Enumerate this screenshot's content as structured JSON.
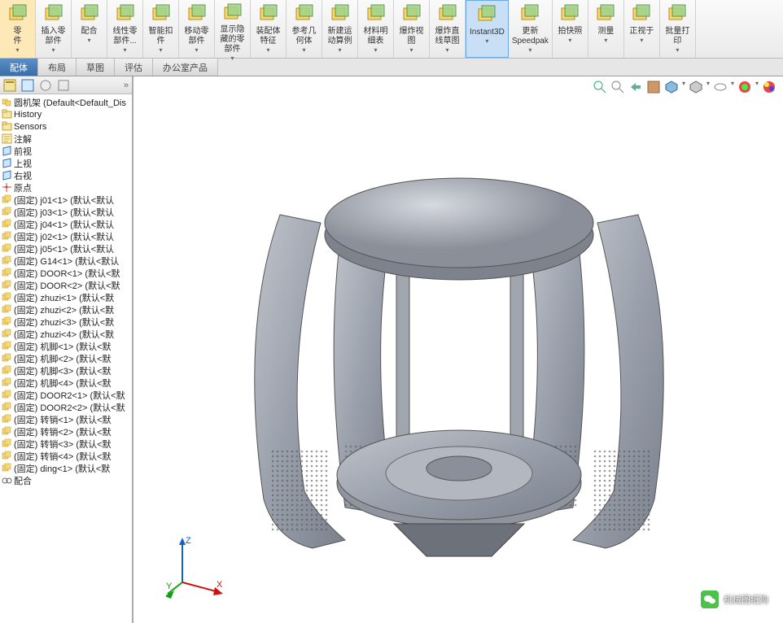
{
  "ribbon": [
    {
      "label": "零\n件",
      "name": "edit-part"
    },
    {
      "label": "插入零\n部件",
      "name": "insert-part"
    },
    {
      "label": "配合",
      "name": "mate"
    },
    {
      "label": "线性零\n部件...",
      "name": "linear-pattern"
    },
    {
      "label": "智能扣\n件",
      "name": "smart-fastener"
    },
    {
      "label": "移动零\n部件",
      "name": "move-component"
    },
    {
      "label": "显示隐\n藏的零\n部件",
      "name": "show-hidden"
    },
    {
      "label": "装配体\n特征",
      "name": "assembly-feature"
    },
    {
      "label": "参考几\n何体",
      "name": "reference-geom"
    },
    {
      "label": "新建运\n动算例",
      "name": "motion-study"
    },
    {
      "label": "材料明\n细表",
      "name": "bom"
    },
    {
      "label": "爆炸视\n图",
      "name": "explode-view"
    },
    {
      "label": "爆炸直\n线草图",
      "name": "explode-line"
    },
    {
      "label": "Instant3D",
      "name": "instant3d",
      "active": true
    },
    {
      "label": "更新\nSpeedpak",
      "name": "update-speedpak"
    },
    {
      "label": "拍快照",
      "name": "snapshot"
    },
    {
      "label": "测量",
      "name": "measure"
    },
    {
      "label": "正视于",
      "name": "normal-to"
    },
    {
      "label": "批量打\n印",
      "name": "batch-print"
    }
  ],
  "tabs": [
    {
      "label": "配体",
      "active": true
    },
    {
      "label": "布局"
    },
    {
      "label": "草图"
    },
    {
      "label": "评估"
    },
    {
      "label": "办公室产品"
    }
  ],
  "tree": {
    "root": "圆机架  (Default<Default_Dis",
    "items": [
      {
        "icon": "folder",
        "label": "History"
      },
      {
        "icon": "folder",
        "label": "Sensors"
      },
      {
        "icon": "ann",
        "label": "注解"
      },
      {
        "icon": "plane",
        "label": "前视"
      },
      {
        "icon": "plane",
        "label": "上视"
      },
      {
        "icon": "plane",
        "label": "右视"
      },
      {
        "icon": "origin",
        "label": "原点"
      },
      {
        "icon": "part",
        "label": "(固定) j01<1> (默认<默认"
      },
      {
        "icon": "part",
        "label": "(固定) j03<1> (默认<默认"
      },
      {
        "icon": "part",
        "label": "(固定) j04<1> (默认<默认"
      },
      {
        "icon": "part",
        "label": "(固定) j02<1> (默认<默认"
      },
      {
        "icon": "part",
        "label": "(固定) j05<1> (默认<默认"
      },
      {
        "icon": "part",
        "label": "(固定) G14<1> (默认<默认"
      },
      {
        "icon": "part",
        "label": "(固定) DOOR<1> (默认<默"
      },
      {
        "icon": "part",
        "label": "(固定) DOOR<2> (默认<默"
      },
      {
        "icon": "part",
        "label": "(固定) zhuzi<1> (默认<默"
      },
      {
        "icon": "part",
        "label": "(固定) zhuzi<2> (默认<默"
      },
      {
        "icon": "part",
        "label": "(固定) zhuzi<3> (默认<默"
      },
      {
        "icon": "part",
        "label": "(固定) zhuzi<4> (默认<默"
      },
      {
        "icon": "part",
        "label": "(固定) 机脚<1> (默认<默"
      },
      {
        "icon": "part",
        "label": "(固定) 机脚<2> (默认<默"
      },
      {
        "icon": "part",
        "label": "(固定) 机脚<3> (默认<默"
      },
      {
        "icon": "part",
        "label": "(固定) 机脚<4> (默认<默"
      },
      {
        "icon": "part",
        "label": "(固定) DOOR2<1> (默认<默"
      },
      {
        "icon": "part",
        "label": "(固定) DOOR2<2> (默认<默"
      },
      {
        "icon": "part",
        "label": "(固定) 转销<1> (默认<默"
      },
      {
        "icon": "part",
        "label": "(固定) 转销<2> (默认<默"
      },
      {
        "icon": "part",
        "label": "(固定) 转销<3> (默认<默"
      },
      {
        "icon": "part",
        "label": "(固定) 转销<4> (默认<默"
      },
      {
        "icon": "part",
        "label": "(固定) ding<1> (默认<默"
      },
      {
        "icon": "mate",
        "label": "配合"
      }
    ]
  },
  "triad": {
    "x": "X",
    "y": "Y",
    "z": "Z"
  },
  "watermark": {
    "prefix": "",
    "text": "机械图纸狗"
  }
}
